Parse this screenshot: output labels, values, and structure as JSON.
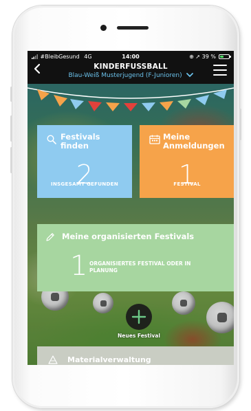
{
  "status_bar": {
    "carrier": "#BleibGesund",
    "network": "4G",
    "time": "14:00",
    "battery_text": "39 %",
    "battery_level": 0.39
  },
  "nav": {
    "title": "KINDERFUSSBALL",
    "subtitle": "Blau-Weiß Musterjugend (F-Junioren)"
  },
  "tiles": {
    "find": {
      "label": "Festivals finden",
      "count": "2",
      "sub": "INSGESAMT GEFUNDEN"
    },
    "registrations": {
      "label": "Meine Anmeldungen",
      "count": "1",
      "sub": "FESTIVAL"
    },
    "organized": {
      "label": "Meine organisierten Festivals",
      "count": "1",
      "sub": "ORGANISIERTES FESTIVAL ODER IN PLANUNG"
    },
    "material": {
      "label": "Materialverwaltung"
    }
  },
  "fab": {
    "label": "Neues Festival"
  },
  "colors": {
    "blue_tile": "#8fcbf0",
    "orange_tile": "#f6a34a",
    "green_tile": "#a7d6a0",
    "subtitle": "#6bc1ea",
    "header": "#111111"
  },
  "icons": {
    "find": "search-icon",
    "registrations": "calendar-icon",
    "organized": "pencil-icon",
    "material": "warning-cone-icon",
    "fab": "plus-icon",
    "back": "chevron-left-icon",
    "menu": "hamburger-menu-icon",
    "subtitle": "chevron-down-icon"
  }
}
